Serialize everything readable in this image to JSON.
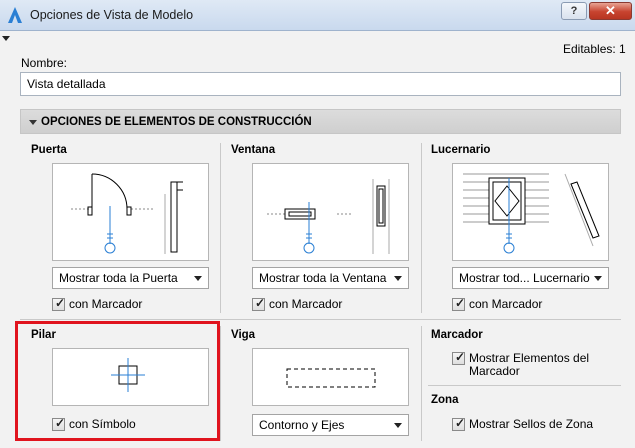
{
  "window": {
    "title": "Opciones de Vista de Modelo",
    "help_label": "?",
    "close_label": "✕"
  },
  "editables": "Editables: 1",
  "nombre": {
    "label": "Nombre:",
    "value": "Vista detallada"
  },
  "section": {
    "title": "OPCIONES DE ELEMENTOS DE CONSTRUCCIÓN"
  },
  "puerta": {
    "title": "Puerta",
    "dropdown": "Mostrar toda la Puerta",
    "check": "con Marcador",
    "checked": true
  },
  "ventana": {
    "title": "Ventana",
    "dropdown": "Mostrar toda la Ventana",
    "check": "con Marcador",
    "checked": true
  },
  "lucernario": {
    "title": "Lucernario",
    "dropdown": "Mostrar tod... Lucernario",
    "check": "con Marcador",
    "checked": true
  },
  "pilar": {
    "title": "Pilar",
    "check": "con Símbolo",
    "checked": true
  },
  "viga": {
    "title": "Viga",
    "dropdown": "Contorno y Ejes"
  },
  "marcador": {
    "title": "Marcador",
    "check": "Mostrar Elementos del Marcador",
    "check_line1": "Mostrar Elementos del",
    "check_line2": "Marcador",
    "checked": true
  },
  "zona": {
    "title": "Zona",
    "check": "Mostrar Sellos de Zona",
    "checked": true
  },
  "icons": {
    "app": "archicad-icon",
    "accent": "#2a7fd4",
    "highlight": "#e0141e"
  }
}
